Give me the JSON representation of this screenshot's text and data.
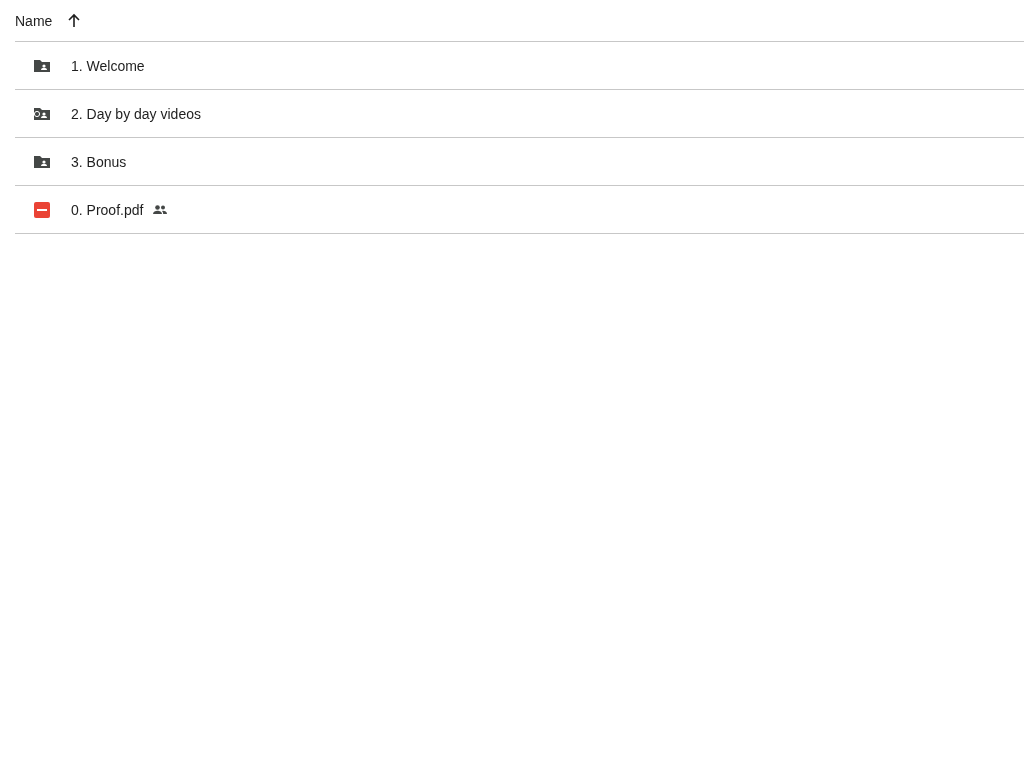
{
  "header": {
    "column": "Name",
    "sort_ascending": true
  },
  "rows": [
    {
      "kind": "shared-folder",
      "name": "1. Welcome",
      "shared": false
    },
    {
      "kind": "video-folder",
      "name": "2. Day by day videos",
      "shared": false
    },
    {
      "kind": "shared-folder",
      "name": "3. Bonus",
      "shared": false
    },
    {
      "kind": "pdf",
      "name": "0. Proof.pdf",
      "shared": true
    }
  ]
}
